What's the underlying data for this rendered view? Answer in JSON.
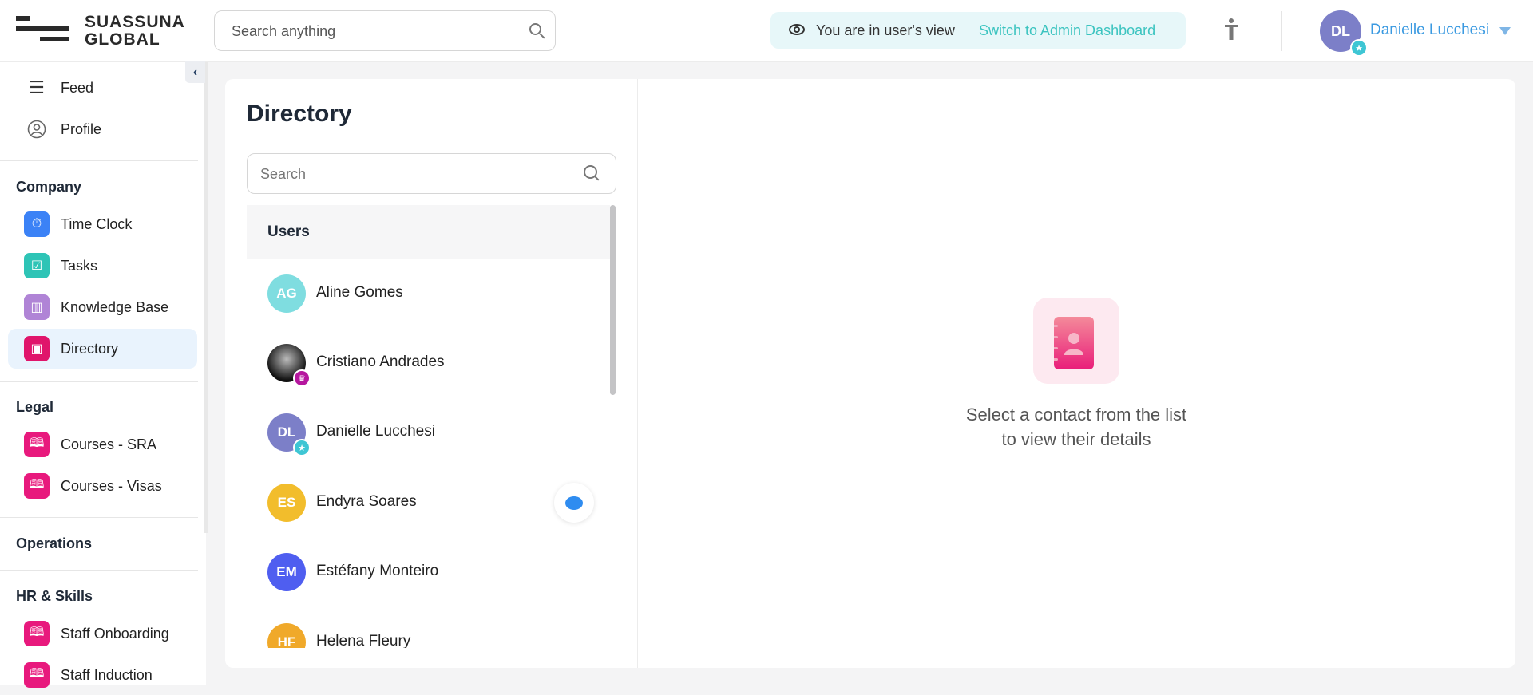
{
  "header": {
    "brand_line1": "SUASSUNA",
    "brand_line2": "GLOBAL",
    "search_placeholder": "Search anything",
    "view_notice": "You are in user's view",
    "switch_link": "Switch to Admin Dashboard",
    "user_initials": "DL",
    "user_name": "Danielle Lucchesi"
  },
  "sidebar": {
    "top": [
      {
        "label": "Feed",
        "icon": "menu-icon"
      },
      {
        "label": "Profile",
        "icon": "user-circle-icon"
      }
    ],
    "sections": [
      {
        "title": "Company",
        "items": [
          {
            "label": "Time Clock",
            "icon": "stopwatch-icon",
            "color": "#3b82f6"
          },
          {
            "label": "Tasks",
            "icon": "tasks-icon",
            "color": "#2ec4b6"
          },
          {
            "label": "Knowledge Base",
            "icon": "knowledge-base-icon",
            "color": "#b084d6"
          },
          {
            "label": "Directory",
            "icon": "directory-icon",
            "color": "#e0156b",
            "active": true
          }
        ]
      },
      {
        "title": "Legal",
        "items": [
          {
            "label": "Courses - SRA",
            "icon": "book-icon",
            "color": "#e8197d"
          },
          {
            "label": "Courses - Visas",
            "icon": "book-icon",
            "color": "#e8197d"
          }
        ]
      },
      {
        "title": "Operations",
        "items": []
      },
      {
        "title": "HR & Skills",
        "items": [
          {
            "label": "Staff Onboarding",
            "icon": "book-icon",
            "color": "#e8197d"
          },
          {
            "label": "Staff Induction",
            "icon": "book-icon",
            "color": "#e8197d"
          }
        ]
      }
    ]
  },
  "directory": {
    "title": "Directory",
    "search_placeholder": "Search",
    "group_label": "Users",
    "users": [
      {
        "initials": "AG",
        "name": "Aline Gomes",
        "color": "#7fdde0"
      },
      {
        "initials": "",
        "name": "Cristiano Andrades",
        "color": "#222222",
        "badge": "crown"
      },
      {
        "initials": "DL",
        "name": "Danielle Lucchesi",
        "color": "#7c7fc8",
        "badge": "star"
      },
      {
        "initials": "ES",
        "name": "Endyra Soares",
        "color": "#f2bd2c"
      },
      {
        "initials": "EM",
        "name": "Estéfany Monteiro",
        "color": "#4f5ef0"
      },
      {
        "initials": "HF",
        "name": "Helena Fleury",
        "color": "#f0a92a"
      }
    ]
  },
  "empty_state": {
    "line1": "Select a contact from the list",
    "line2": "to view their details"
  }
}
